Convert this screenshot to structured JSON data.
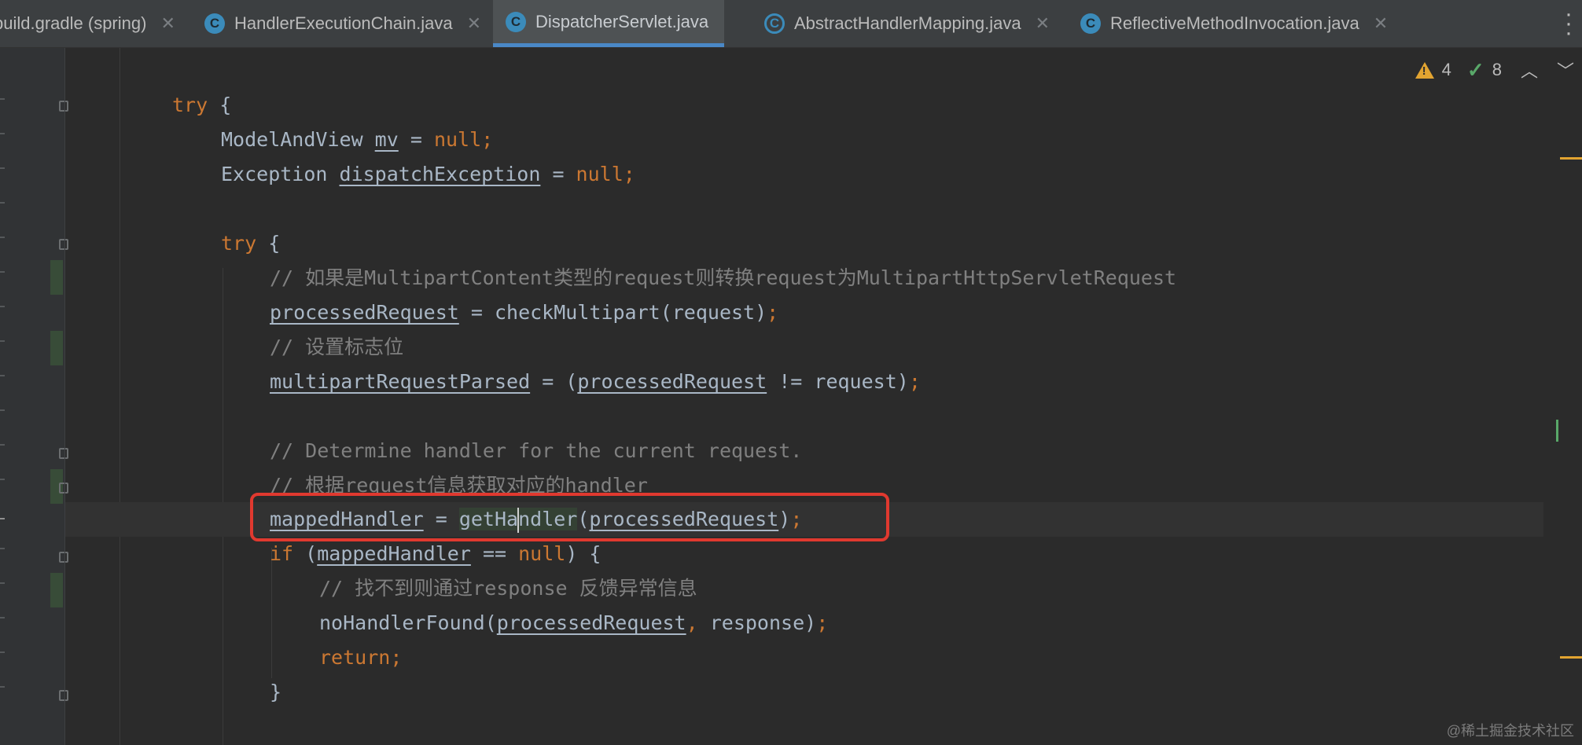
{
  "tabs": [
    {
      "label": "build.gradle (spring)",
      "icon": "gradle-icon"
    },
    {
      "label": "HandlerExecutionChain.java",
      "icon": "class-icon"
    },
    {
      "label": "DispatcherServlet.java",
      "icon": "class-icon",
      "active": true
    },
    {
      "label": "AbstractHandlerMapping.java",
      "icon": "abstract-class-icon"
    },
    {
      "label": "ReflectiveMethodInvocation.java",
      "icon": "class-icon"
    }
  ],
  "class_icon_letter": "C",
  "inspection": {
    "warnings": "4",
    "weak_warnings": "8"
  },
  "code": {
    "l1_kw": "try",
    "l1_rest": " {",
    "l2_type": "ModelAndView ",
    "l2_var": "mv",
    "l2_eq": " = ",
    "l2_null": "null",
    "l2_semi": ";",
    "l3_type": "Exception ",
    "l3_var": "dispatchException",
    "l3_eq": " = ",
    "l3_null": "null",
    "l3_semi": ";",
    "l5_kw": "try",
    "l5_rest": " {",
    "l6_comment": "// 如果是MultipartContent类型的request则转换request为MultipartHttpServletRequest",
    "l7_var": "processedRequest",
    "l7_mid": " = checkMultipart(request)",
    "l7_semi": ";",
    "l8_comment": "// 设置标志位",
    "l9_var": "multipartRequestParsed",
    "l9_mid": " = (",
    "l9_var2": "processedRequest",
    "l9_end": " != request)",
    "l9_semi": ";",
    "l11_comment": "// Determine handler for the current request.",
    "l12_comment": "// 根据request信息获取对应的handler",
    "l13_var": "mappedHandler",
    "l13_eq": " = ",
    "l13_call_a": "getHa",
    "l13_call_b": "ndler",
    "l13_open": "(",
    "l13_arg": "processedRequest",
    "l13_close": ")",
    "l13_semi": ";",
    "l14_kw": "if",
    "l14_open": " (",
    "l14_var": "mappedHandler",
    "l14_mid": " == ",
    "l14_null": "null",
    "l14_end": ") {",
    "l15_comment": "// 找不到则通过response 反馈异常信息",
    "l16_call": "noHandlerFound(",
    "l16_arg": "processedRequest",
    "l16_comma": ",",
    "l16_rest": " response)",
    "l16_semi": ";",
    "l17_kw": "return",
    "l17_semi": ";",
    "l18_brace": "}"
  },
  "watermark": "@稀土掘金技术社区",
  "colors": {
    "keyword": "#cc7832",
    "comment": "#808080",
    "text": "#a9b7c6",
    "highlight_box": "#e0392f",
    "tab_accent": "#4a88c7"
  }
}
